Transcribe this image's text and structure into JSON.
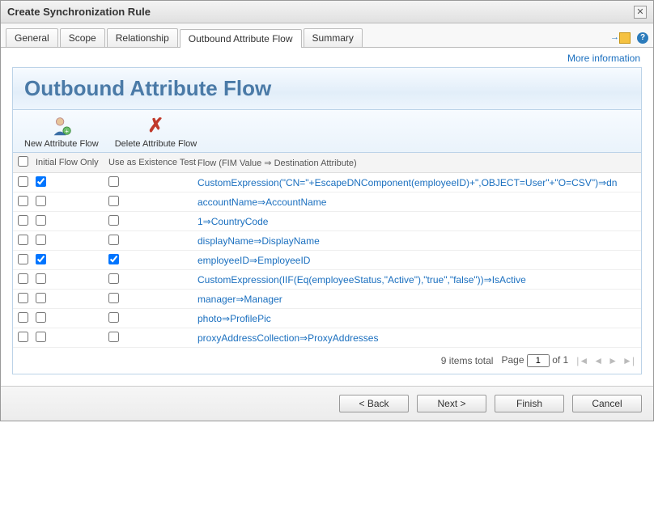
{
  "window": {
    "title": "Create Synchronization Rule"
  },
  "tabs": [
    {
      "label": "General"
    },
    {
      "label": "Scope"
    },
    {
      "label": "Relationship"
    },
    {
      "label": "Outbound Attribute Flow"
    },
    {
      "label": "Summary"
    }
  ],
  "active_tab_index": 3,
  "more_info_label": "More information",
  "panel_title": "Outbound Attribute Flow",
  "toolbar": {
    "new_flow": "New Attribute Flow",
    "delete_flow": "Delete Attribute Flow"
  },
  "columns": {
    "initial_flow_only": "Initial Flow Only",
    "use_as_existence_test": "Use as Existence Test",
    "flow": "Flow (FIM Value ⇒ Destination Attribute)"
  },
  "rows": [
    {
      "selected": false,
      "initial": true,
      "existence": false,
      "flow": "CustomExpression(\"CN=\"+EscapeDNComponent(employeeID)+\",OBJECT=User\"+\"O=CSV\")⇒dn"
    },
    {
      "selected": false,
      "initial": false,
      "existence": false,
      "flow": "accountName⇒AccountName"
    },
    {
      "selected": false,
      "initial": false,
      "existence": false,
      "flow": "1⇒CountryCode"
    },
    {
      "selected": false,
      "initial": false,
      "existence": false,
      "flow": "displayName⇒DisplayName"
    },
    {
      "selected": false,
      "initial": true,
      "existence": true,
      "flow": "employeeID⇒EmployeeID"
    },
    {
      "selected": false,
      "initial": false,
      "existence": false,
      "flow": "CustomExpression(IIF(Eq(employeeStatus,\"Active\"),\"true\",\"false\"))⇒IsActive"
    },
    {
      "selected": false,
      "initial": false,
      "existence": false,
      "flow": "manager⇒Manager"
    },
    {
      "selected": false,
      "initial": false,
      "existence": false,
      "flow": "photo⇒ProfilePic"
    },
    {
      "selected": false,
      "initial": false,
      "existence": false,
      "flow": "proxyAddressCollection⇒ProxyAddresses"
    }
  ],
  "pager": {
    "total_text": "9 items total",
    "page_label": "Page",
    "page_value": "1",
    "of_label": "of 1"
  },
  "buttons": {
    "back": "< Back",
    "next": "Next >",
    "finish": "Finish",
    "cancel": "Cancel"
  }
}
